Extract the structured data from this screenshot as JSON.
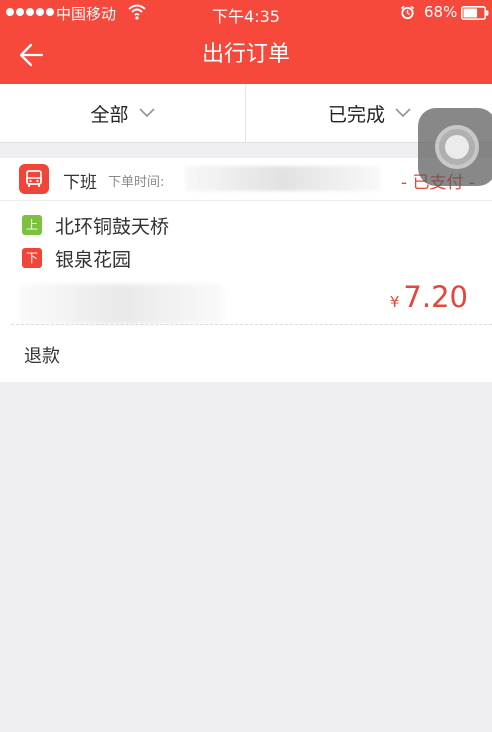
{
  "status_bar": {
    "carrier": "中国移动",
    "time": "下午4:35",
    "battery": "68%",
    "battery_level": 0.68,
    "signal_bars": 5,
    "icons": [
      "signal-icon",
      "wifi-icon",
      "alarm-icon",
      "battery-icon"
    ]
  },
  "header": {
    "title": "出行订单",
    "back_icon": "back-arrow-icon"
  },
  "filters": {
    "category": "全部",
    "status": "已完成",
    "chevron_icon": "chevron-down-icon"
  },
  "order": {
    "type": "下班",
    "time_label": "下单时间:",
    "status": "- 已支付 -",
    "pickup_badge": "上",
    "pickup": "北环铜鼓天桥",
    "dropoff_badge": "下",
    "dropoff": "银泉花园",
    "currency": "¥",
    "price": "7.20",
    "refund_label": "退款",
    "bus_icon": "bus-icon"
  },
  "colors": {
    "brand": "#f6483b",
    "accent_text": "#e4463c",
    "pickup_green": "#7cc23c",
    "background": "#efeff1"
  }
}
